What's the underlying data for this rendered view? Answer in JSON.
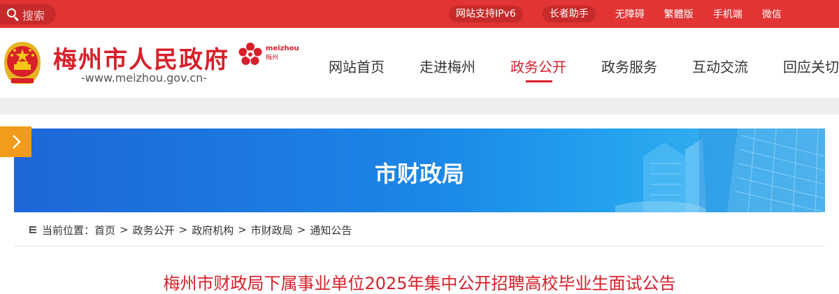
{
  "topbar": {
    "search_placeholder": "搜索",
    "links": [
      {
        "label": "网站支持IPv6",
        "style": "pill"
      },
      {
        "label": "长者助手",
        "style": "pill"
      },
      {
        "label": "无障碍",
        "style": "plain"
      },
      {
        "label": "繁體版",
        "style": "plain"
      },
      {
        "label": "手机端",
        "style": "plain"
      },
      {
        "label": "微信",
        "style": "plain"
      }
    ]
  },
  "header": {
    "site_title": "梅州市人民政府",
    "site_url": "-www.meizhou.gov.cn-",
    "logo_text_latin": "meizhou",
    "logo_text_cn": "梅州"
  },
  "nav": {
    "items": [
      {
        "label": "网站首页"
      },
      {
        "label": "走进梅州"
      },
      {
        "label": "政务公开",
        "active": true
      },
      {
        "label": "政务服务"
      },
      {
        "label": "互动交流"
      },
      {
        "label": "回应关切"
      }
    ]
  },
  "banner": {
    "title": "市财政局"
  },
  "breadcrumb": {
    "prefix": "当前位置：",
    "items": [
      "首页",
      "政务公开",
      "政府机构",
      "市财政局",
      "通知公告"
    ]
  },
  "article": {
    "title": "梅州市财政局下属事业单位2025年集中公开招聘高校毕业生面试公告"
  },
  "colors": {
    "brand_red": "#e23434",
    "title_red": "#d7202a",
    "banner_blue": "#1b86e6",
    "side_tab_orange": "#f29b1c"
  }
}
